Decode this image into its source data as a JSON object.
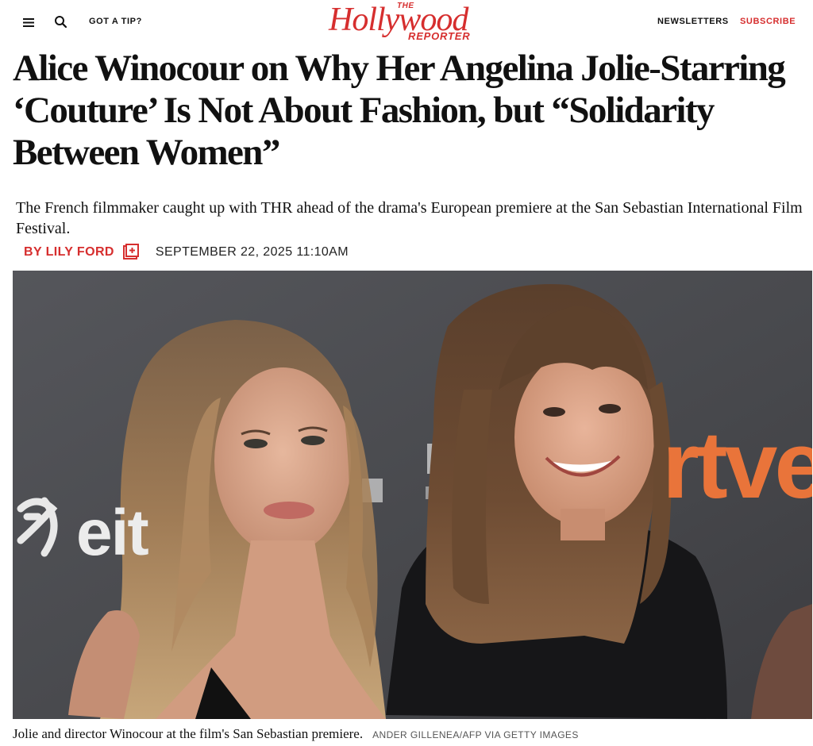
{
  "header": {
    "menu_icon": "hamburger-menu-icon",
    "search_icon": "search-icon",
    "tip_label": "GOT A TIP?",
    "logo": {
      "the": "THE",
      "main": "Hollywood",
      "reporter": "REPORTER"
    },
    "newsletters_label": "NEWSLETTERS",
    "subscribe_label": "SUBSCRIBE"
  },
  "article": {
    "headline": "Alice Winocour on Why Her Angelina Jolie-Starring ‘Couture’ Is Not About Fashion, but “Solidarity Between Women”",
    "dek": "The French filmmaker caught up with THR ahead of the drama's European premiere at the San Sebastian International Film Festival.",
    "byline": "BY LILY FORD",
    "author_icon": "author-bio-icon",
    "date": "SEPTEMBER 22, 2025 11:10AM"
  },
  "photo": {
    "background_text_right": "rtve",
    "background_text_left": "eit",
    "caption": "Jolie and director Winocour at the film's San Sebastian premiere.",
    "credit": "ANDER GILLENEA/AFP VIA GETTY IMAGES"
  },
  "colors": {
    "brand_red": "#d62e2e",
    "text": "#111111",
    "backdrop": "#4a4b4f",
    "rtve_orange": "#e9743a"
  }
}
